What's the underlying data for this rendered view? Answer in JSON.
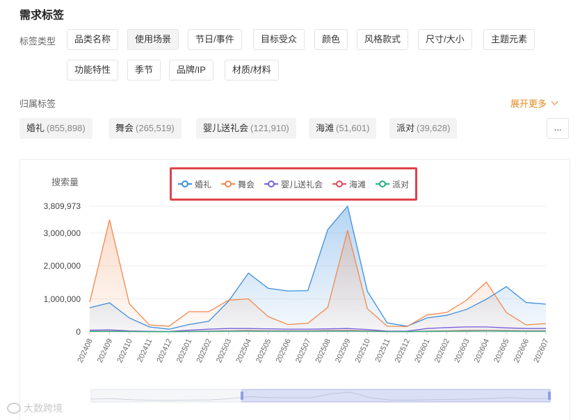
{
  "page": {
    "title": "需求标签"
  },
  "tag_types": {
    "label": "标签类型",
    "items": [
      "品类名称",
      "使用场景",
      "节日/事件",
      "目标受众",
      "颜色",
      "风格款式",
      "尺寸/大小",
      "主题元素",
      "功能特性",
      "季节",
      "品牌/IP",
      "材质/材料"
    ],
    "active": "使用场景"
  },
  "belong_tags": {
    "label": "归属标签",
    "expand_label": "展开更多",
    "more_label": "...",
    "items": [
      {
        "name": "婚礼",
        "count": "(855,898)"
      },
      {
        "name": "舞会",
        "count": "(265,519)"
      },
      {
        "name": "婴儿送礼会",
        "count": "(121,910)"
      },
      {
        "name": "海滩",
        "count": "(51,601)"
      },
      {
        "name": "派对",
        "count": "(39,628)"
      }
    ]
  },
  "watermark": "大数跨境",
  "chart_data": {
    "type": "area",
    "ylabel": "搜索量",
    "yticks": [
      "3,809,973",
      "3,000,000",
      "2,000,000",
      "1,000,000",
      "0"
    ],
    "ytick_values": [
      3809973,
      3000000,
      2000000,
      1000000,
      0
    ],
    "ylim": [
      0,
      3809973
    ],
    "legend_position": "top-center",
    "x": [
      "202408",
      "202409",
      "202410",
      "202411",
      "202412",
      "202501",
      "202502",
      "202503",
      "202504",
      "202505",
      "202506",
      "202507",
      "202508",
      "202509",
      "202510",
      "202511",
      "202512",
      "202601",
      "202602",
      "202603",
      "202604",
      "202605",
      "202606",
      "202607"
    ],
    "series": [
      {
        "name": "婚礼",
        "color": "#3c8ede",
        "values": [
          730000,
          880000,
          420000,
          150000,
          80000,
          220000,
          320000,
          930000,
          1780000,
          1320000,
          1240000,
          1250000,
          3100000,
          3809973,
          1230000,
          270000,
          170000,
          420000,
          500000,
          680000,
          990000,
          1370000,
          890000,
          840000
        ]
      },
      {
        "name": "舞会",
        "color": "#f0884c",
        "values": [
          900000,
          3400000,
          850000,
          210000,
          170000,
          610000,
          610000,
          960000,
          1000000,
          460000,
          220000,
          260000,
          740000,
          3080000,
          700000,
          170000,
          160000,
          510000,
          590000,
          960000,
          1510000,
          590000,
          210000,
          250000
        ]
      },
      {
        "name": "婴儿送礼会",
        "color": "#7a5ddc",
        "values": [
          50000,
          60000,
          30000,
          15000,
          10000,
          50000,
          80000,
          100000,
          100000,
          90000,
          80000,
          80000,
          90000,
          100000,
          70000,
          20000,
          20000,
          100000,
          130000,
          150000,
          150000,
          120000,
          100000,
          100000
        ]
      },
      {
        "name": "海滩",
        "color": "#e8455a",
        "values": [
          20000,
          20000,
          15000,
          8000,
          6000,
          15000,
          20000,
          30000,
          35000,
          30000,
          30000,
          30000,
          35000,
          40000,
          25000,
          10000,
          8000,
          20000,
          30000,
          40000,
          40000,
          35000,
          30000,
          30000
        ]
      },
      {
        "name": "派对",
        "color": "#23b07e",
        "values": [
          15000,
          15000,
          10000,
          6000,
          5000,
          10000,
          15000,
          20000,
          25000,
          20000,
          20000,
          20000,
          25000,
          25000,
          18000,
          8000,
          6000,
          15000,
          20000,
          25000,
          30000,
          25000,
          20000,
          20000
        ]
      }
    ]
  }
}
